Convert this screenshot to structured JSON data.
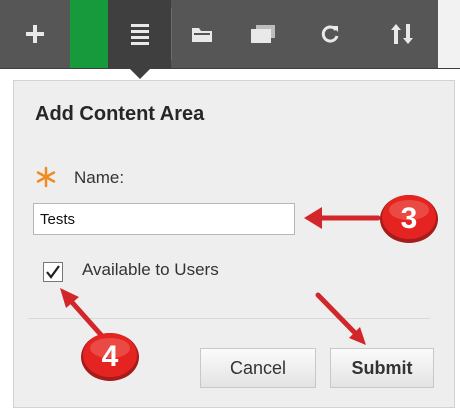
{
  "toolbar": {
    "items": [
      {
        "name": "add-icon"
      },
      {
        "name": "active-tab"
      },
      {
        "name": "list-icon"
      },
      {
        "name": "folder-icon"
      },
      {
        "name": "window-icon"
      },
      {
        "name": "refresh-icon"
      },
      {
        "name": "sort-icon"
      }
    ]
  },
  "dialog": {
    "title": "Add Content Area",
    "name_label": "Name:",
    "name_value": "Tests",
    "available_checked": true,
    "available_label": "Available to Users",
    "cancel_label": "Cancel",
    "submit_label": "Submit"
  },
  "callouts": {
    "step_3": "3",
    "step_4": "4"
  },
  "colors": {
    "toolbar_bg": "#565656",
    "active_green": "#179a3c",
    "active_dark": "#3f3f3f",
    "required_star": "#f28b1f",
    "callout_red": "#e52421",
    "arrow_red": "#d3262a"
  }
}
